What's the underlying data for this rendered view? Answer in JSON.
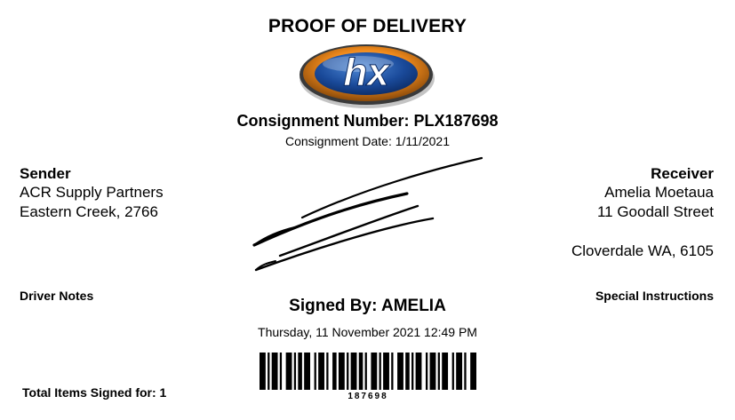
{
  "header": {
    "title": "PROOF OF DELIVERY",
    "logo_text": "hx"
  },
  "consignment": {
    "number_label": "Consignment Number: PLX187698",
    "date_label": "Consignment Date: 1/11/2021"
  },
  "sender": {
    "heading": "Sender",
    "name": "ACR Supply Partners",
    "address": "Eastern Creek, 2766"
  },
  "receiver": {
    "heading": "Receiver",
    "name": "Amelia Moetaua",
    "street": "11 Goodall Street",
    "city": "Cloverdale WA, 6105"
  },
  "notes": {
    "driver_notes_label": "Driver Notes",
    "special_instructions_label": "Special Instructions"
  },
  "signature": {
    "signed_by": "Signed By: AMELIA",
    "signed_at": "Thursday, 11 November 2021 12:49 PM"
  },
  "footer": {
    "total_items": "Total Items Signed for: 1",
    "barcode_number": "187698"
  },
  "colors": {
    "logo_orange": "#e07a10",
    "logo_blue": "#1a4a9a",
    "text": "#000000"
  }
}
